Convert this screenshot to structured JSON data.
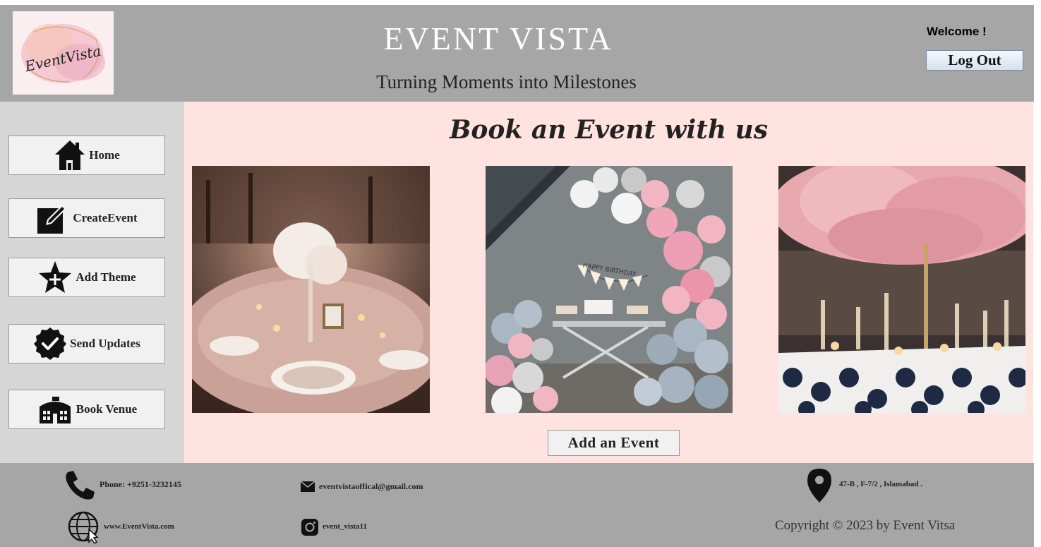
{
  "header": {
    "logo_text": "EventVista",
    "title": "EVENT VISTA",
    "tagline": "Turning Moments into Milestones",
    "welcome": "Welcome !",
    "logout_label": "Log Out"
  },
  "sidebar": {
    "items": [
      {
        "label": "Home",
        "icon": "home-icon"
      },
      {
        "label": "CreateEvent",
        "icon": "edit-icon"
      },
      {
        "label": "Add Theme",
        "icon": "star-plus-icon"
      },
      {
        "label": "Send Updates",
        "icon": "check-badge-icon"
      },
      {
        "label": "Book Venue",
        "icon": "building-icon"
      }
    ]
  },
  "main": {
    "title": "Book an Event with us",
    "images": [
      "wedding-table-setting-photo",
      "birthday-balloon-arch-photo",
      "feather-centerpiece-table-photo"
    ],
    "birthday_banner": "HAPPY BIRTHDAY",
    "add_event_label": "Add an Event"
  },
  "footer": {
    "phone": "Phone: +9251-3232145",
    "email": "eventvistaoffical@gmail.com",
    "address": "47-B , F-7/2 , Islamabad .",
    "website": "www.EventVista.com",
    "instagram": "event_vista11",
    "copyright": "Copyright © 2023 by Event Vitsa"
  },
  "colors": {
    "header_bg": "#a6a6a6",
    "sidebar_bg": "#d6d6d6",
    "main_bg": "#ffe3e0",
    "button_bg": "#f1f1f1"
  }
}
